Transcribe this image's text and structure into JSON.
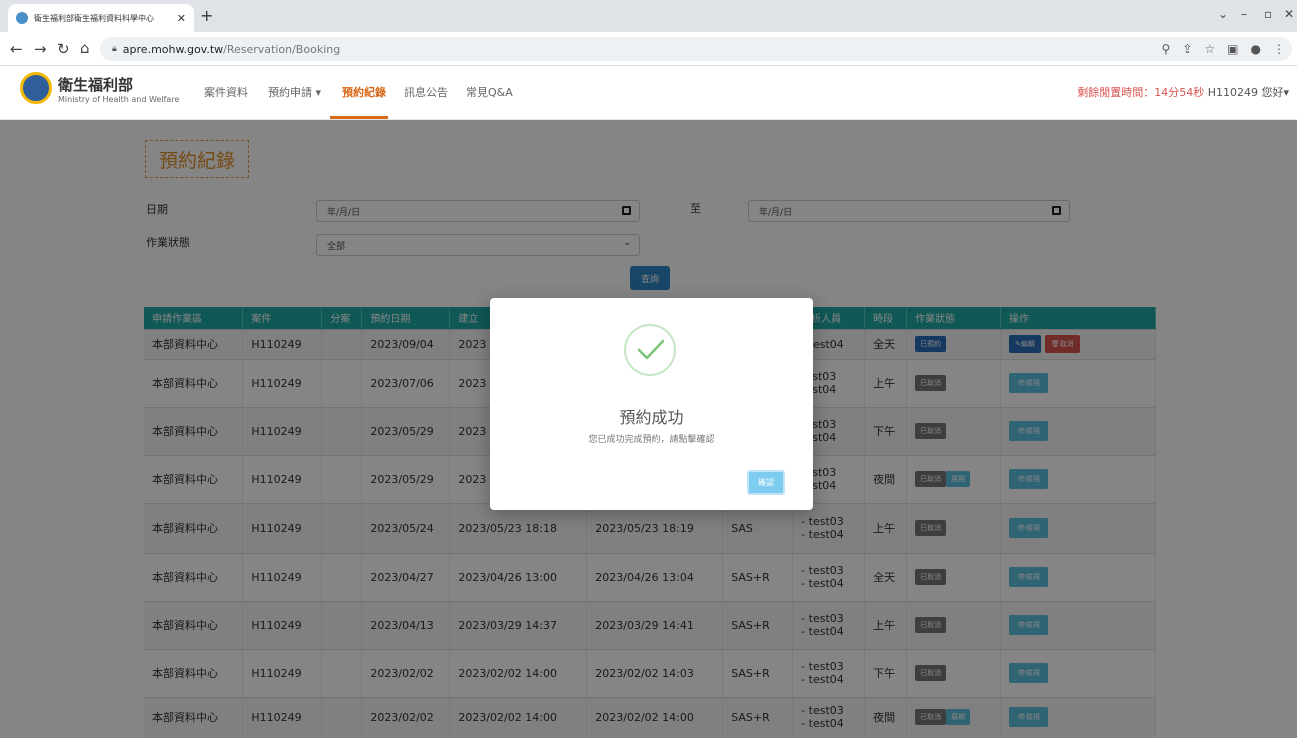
{
  "browser": {
    "tab_title": "衛生福利部衛生福利資料科學中心",
    "url_host": "apre.mohw.gov.tw",
    "url_path": "/Reservation/Booking"
  },
  "header": {
    "brand": "衛生福利部",
    "brand_en": "Ministry of Health and Welfare",
    "nav": [
      "案件資料",
      "預約申請 ▾",
      "預約紀錄",
      "訊息公告",
      "常見Q&A"
    ],
    "session_label": "剩餘閒置時間：",
    "session_time": "14分54秒",
    "user": "H110249 您好▾"
  },
  "page": {
    "title": "預約紀錄",
    "date_label": "日期",
    "date_from_placeholder": "年/月/日",
    "to_label": "至",
    "date_to_placeholder": "年/月/日",
    "status_label": "作業狀態",
    "status_value": "全部",
    "query_button": "查詢"
  },
  "table": {
    "headers": [
      "申請作業區",
      "案件",
      "分案",
      "預約日期",
      "建立",
      "",
      "",
      "分析人員",
      "時段",
      "作業狀態",
      "操作"
    ],
    "rows": [
      {
        "area": "本部資料中心",
        "case": "H110249",
        "sub": "",
        "date": "2023/09/04",
        "created": "2023",
        "modified": "",
        "software": "",
        "analysts": "- test04",
        "period": "全天",
        "status": [
          "已預約"
        ],
        "actions": [
          "編輯",
          "取消"
        ]
      },
      {
        "area": "本部資料中心",
        "case": "H110249",
        "sub": "",
        "date": "2023/07/06",
        "created": "2023",
        "modified": "",
        "software": "",
        "analysts": "test03\ntest04",
        "period": "上午",
        "status": [
          "已取消"
        ],
        "actions": [
          "檢視"
        ]
      },
      {
        "area": "本部資料中心",
        "case": "H110249",
        "sub": "",
        "date": "2023/05/29",
        "created": "2023",
        "modified": "",
        "software": "",
        "analysts": "test03\ntest04",
        "period": "下午",
        "status": [
          "已取消"
        ],
        "actions": [
          "檢視"
        ]
      },
      {
        "area": "本部資料中心",
        "case": "H110249",
        "sub": "",
        "date": "2023/05/29",
        "created": "2023",
        "modified": "",
        "software": "",
        "analysts": "test03\ntest04",
        "period": "夜間",
        "status": [
          "已取消",
          "展期"
        ],
        "actions": [
          "檢視"
        ]
      },
      {
        "area": "本部資料中心",
        "case": "H110249",
        "sub": "",
        "date": "2023/05/24",
        "created": "2023/05/23 18:18",
        "modified": "2023/05/23 18:19",
        "software": "SAS",
        "analysts": "- test03\n- test04",
        "period": "上午",
        "status": [
          "已取消"
        ],
        "actions": [
          "檢視"
        ]
      },
      {
        "area": "本部資料中心",
        "case": "H110249",
        "sub": "",
        "date": "2023/04/27",
        "created": "2023/04/26 13:00",
        "modified": "2023/04/26 13:04",
        "software": "SAS+R",
        "analysts": "- test03\n- test04",
        "period": "全天",
        "status": [
          "已取消"
        ],
        "actions": [
          "檢視"
        ]
      },
      {
        "area": "本部資料中心",
        "case": "H110249",
        "sub": "",
        "date": "2023/04/13",
        "created": "2023/03/29 14:37",
        "modified": "2023/03/29 14:41",
        "software": "SAS+R",
        "analysts": "- test03\n- test04",
        "period": "上午",
        "status": [
          "已取消"
        ],
        "actions": [
          "檢視"
        ]
      },
      {
        "area": "本部資料中心",
        "case": "H110249",
        "sub": "",
        "date": "2023/02/02",
        "created": "2023/02/02 14:00",
        "modified": "2023/02/02 14:03",
        "software": "SAS+R",
        "analysts": "- test03\n- test04",
        "period": "下午",
        "status": [
          "已取消"
        ],
        "actions": [
          "檢視"
        ]
      },
      {
        "area": "本部資料中心",
        "case": "H110249",
        "sub": "",
        "date": "2023/02/02",
        "created": "2023/02/02 14:00",
        "modified": "2023/02/02 14:00",
        "software": "SAS+R",
        "analysts": "- test03\n- test04",
        "period": "夜間",
        "status": [
          "已取消",
          "展期"
        ],
        "actions": [
          "檢視"
        ]
      }
    ]
  },
  "modal": {
    "title": "預約成功",
    "message": "您已成功完成預約，請點擊確認",
    "confirm": "確認"
  },
  "colors": {
    "accent_orange": "#d86a1a",
    "table_header": "#1faaa6",
    "primary_blue": "#2f86c4",
    "danger_red": "#d9534f"
  }
}
